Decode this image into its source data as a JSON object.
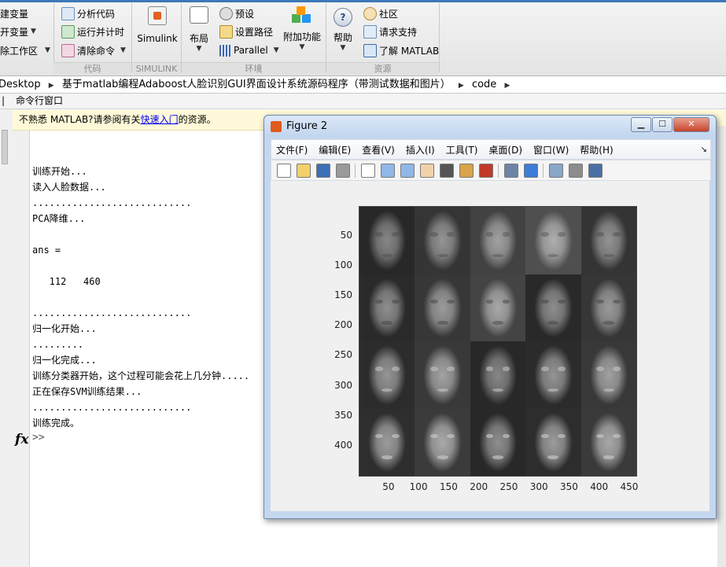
{
  "ribbon": {
    "col1": [
      "建变量",
      "开变量",
      "除工作区"
    ],
    "code_items": [
      "分析代码",
      "运行并计时",
      "清除命令"
    ],
    "simulink": "Simulink",
    "layout": "布局",
    "env_items": [
      "预设",
      "设置路径",
      "Parallel"
    ],
    "addons": "附加功能",
    "help": "帮助",
    "resource_items": [
      "社区",
      "请求支持",
      "了解 MATLAB"
    ],
    "sections": [
      "代码",
      "SIMULINK",
      "环境",
      "资源"
    ]
  },
  "address": {
    "crumbs": [
      "Desktop",
      "基于matlab编程Adaboost人脸识别GUI界面设计系统源码程序（带测试数据和图片）",
      "code"
    ]
  },
  "command_window": {
    "title": "命令行窗口",
    "notice_prefix": "不熟悉 MATLAB?请参阅有关",
    "notice_link": "快速入门",
    "notice_suffix": "的资源。",
    "lines": [
      "训练开始...",
      "读入人脸数据...",
      "............................",
      "PCA降维...",
      "",
      "ans =",
      "",
      "   112   460",
      "",
      "............................",
      "归一化开始...",
      ".........",
      "归一化完成...",
      "训练分类器开始，这个过程可能会花上几分钟.....",
      "正在保存SVM训练结果...",
      "............................",
      "训练完成。"
    ],
    "fx": "fx",
    "prompt": ">>"
  },
  "figure": {
    "title": "Figure 2",
    "menu": [
      "文件(F)",
      "编辑(E)",
      "查看(V)",
      "插入(I)",
      "工具(T)",
      "桌面(D)",
      "窗口(W)",
      "帮助(H)"
    ],
    "toolbar_icons": [
      "new-figure-icon",
      "open-icon",
      "save-icon",
      "print-icon",
      "pointer-icon",
      "zoom-in-icon",
      "zoom-out-icon",
      "pan-icon",
      "rotate-icon",
      "data-cursor-icon",
      "brush-icon",
      "link-icon",
      "colorbar-icon",
      "legend-icon",
      "hide-tools-icon",
      "show-tools-icon"
    ],
    "colors": {
      "titlebar": "#c8daf0",
      "plot_bg": "#777777"
    }
  },
  "chart_data": {
    "type": "image",
    "description_grid": {
      "rows": 4,
      "cols": 5
    },
    "xticks": [
      50,
      100,
      150,
      200,
      250,
      300,
      350,
      400,
      450
    ],
    "yticks": [
      50,
      100,
      150,
      200,
      250,
      300,
      350,
      400
    ],
    "xlim": [
      0.5,
      460.5
    ],
    "ylim": [
      0.5,
      448.5
    ]
  }
}
